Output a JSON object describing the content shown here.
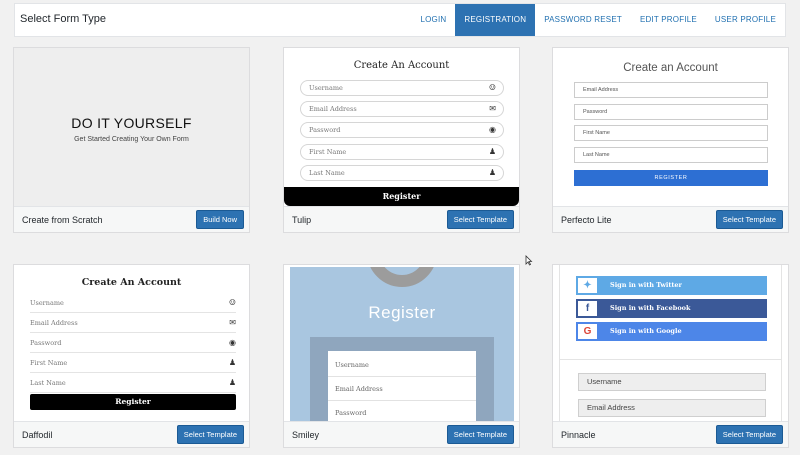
{
  "header": {
    "title": "Select Form Type",
    "tabs": [
      "LOGIN",
      "REGISTRATION",
      "PASSWORD RESET",
      "EDIT PROFILE",
      "USER PROFILE"
    ],
    "active_tab": "REGISTRATION"
  },
  "cards": {
    "scratch": {
      "name": "Create from Scratch",
      "button": "Build Now",
      "preview_title": "DO IT YOURSELF",
      "preview_subtitle": "Get Started Creating Your Own Form"
    },
    "tulip": {
      "name": "Tulip",
      "button": "Select Template",
      "preview_title": "Create An Account",
      "fields": [
        "Username",
        "Email Address",
        "Password",
        "First Name",
        "Last Name"
      ],
      "submit": "Register"
    },
    "perfecto": {
      "name": "Perfecto Lite",
      "button": "Select Template",
      "preview_title": "Create an Account",
      "fields": [
        "Email Address",
        "Password",
        "First Name",
        "Last Name"
      ],
      "submit": "REGISTER"
    },
    "daffodil": {
      "name": "Daffodil",
      "button": "Select Template",
      "preview_title": "Create An Account",
      "fields": [
        "Username",
        "Email Address",
        "Password",
        "First Name",
        "Last Name"
      ],
      "submit": "Register"
    },
    "smiley": {
      "name": "Smiley",
      "button": "Select Template",
      "preview_title": "Register",
      "fields": [
        "Username",
        "Email Address",
        "Password"
      ]
    },
    "pinnacle": {
      "name": "Pinnacle",
      "button": "Select Template",
      "social": [
        "Sign in with Twitter",
        "Sign in with Facebook",
        "Sign in with Google"
      ],
      "fields": [
        "Username",
        "Email Address"
      ]
    }
  },
  "colors": {
    "accent": "#2d72b2",
    "twitter": "#5ea9e5",
    "facebook": "#3b5998",
    "google": "#4d86e8"
  },
  "icons": {
    "username": "smiley-icon",
    "email": "envelope-icon",
    "password": "eye-icon",
    "first_name": "user-icon",
    "last_name": "user-icon"
  }
}
